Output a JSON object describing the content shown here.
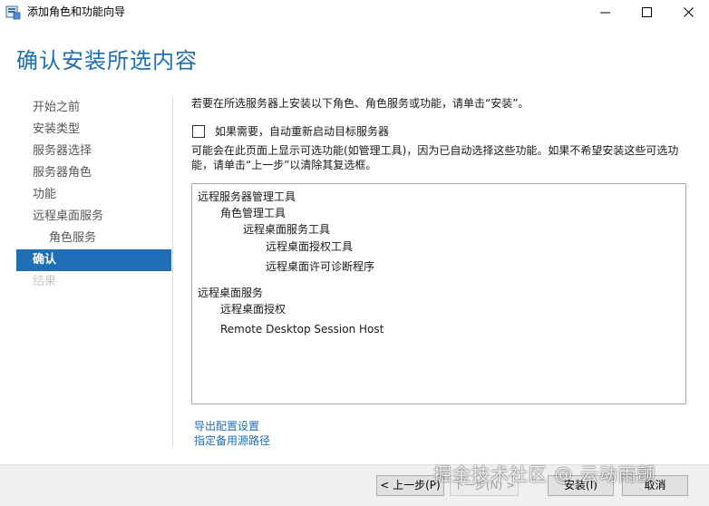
{
  "window": {
    "title": "添加角色和功能向导",
    "icon": "server-manager-icon"
  },
  "page": {
    "title": "确认安装所选内容"
  },
  "sidebar": {
    "items": [
      {
        "label": "开始之前",
        "state": "normal"
      },
      {
        "label": "安装类型",
        "state": "normal"
      },
      {
        "label": "服务器选择",
        "state": "normal"
      },
      {
        "label": "服务器角色",
        "state": "normal"
      },
      {
        "label": "功能",
        "state": "normal"
      },
      {
        "label": "远程桌面服务",
        "state": "normal"
      },
      {
        "label": "角色服务",
        "state": "sub"
      },
      {
        "label": "确认",
        "state": "active"
      },
      {
        "label": "结果",
        "state": "disabled"
      }
    ]
  },
  "content": {
    "intro": "若要在所选服务器上安装以下角色、角色服务或功能，请单击“安装”。",
    "restart_checkbox": {
      "label": "如果需要，自动重新启动目标服务器",
      "checked": false
    },
    "note": "可能会在此页面上显示可选功能(如管理工具)，因为已自动选择这些功能。如果不希望安装这些可选功能，请单击“上一步”以清除其复选框。",
    "selection": [
      "远程服务器管理工具",
      "角色管理工具",
      "远程桌面服务工具",
      "远程桌面授权工具",
      "远程桌面许可诊断程序",
      "远程桌面服务",
      "远程桌面授权",
      "Remote Desktop Session Host"
    ],
    "links": {
      "export": "导出配置设置",
      "alternate_source": "指定备用源路径"
    }
  },
  "buttons": {
    "previous": "< 上一步(P)",
    "next": "下一步(N) >",
    "install": "安装(I)",
    "cancel": "取消"
  },
  "watermark": "掘金技术社区 @ 云动雨颤",
  "colors": {
    "accent": "#1e6fb5",
    "link": "#1e6fb5",
    "disabled_text": "#c8c8c8"
  }
}
